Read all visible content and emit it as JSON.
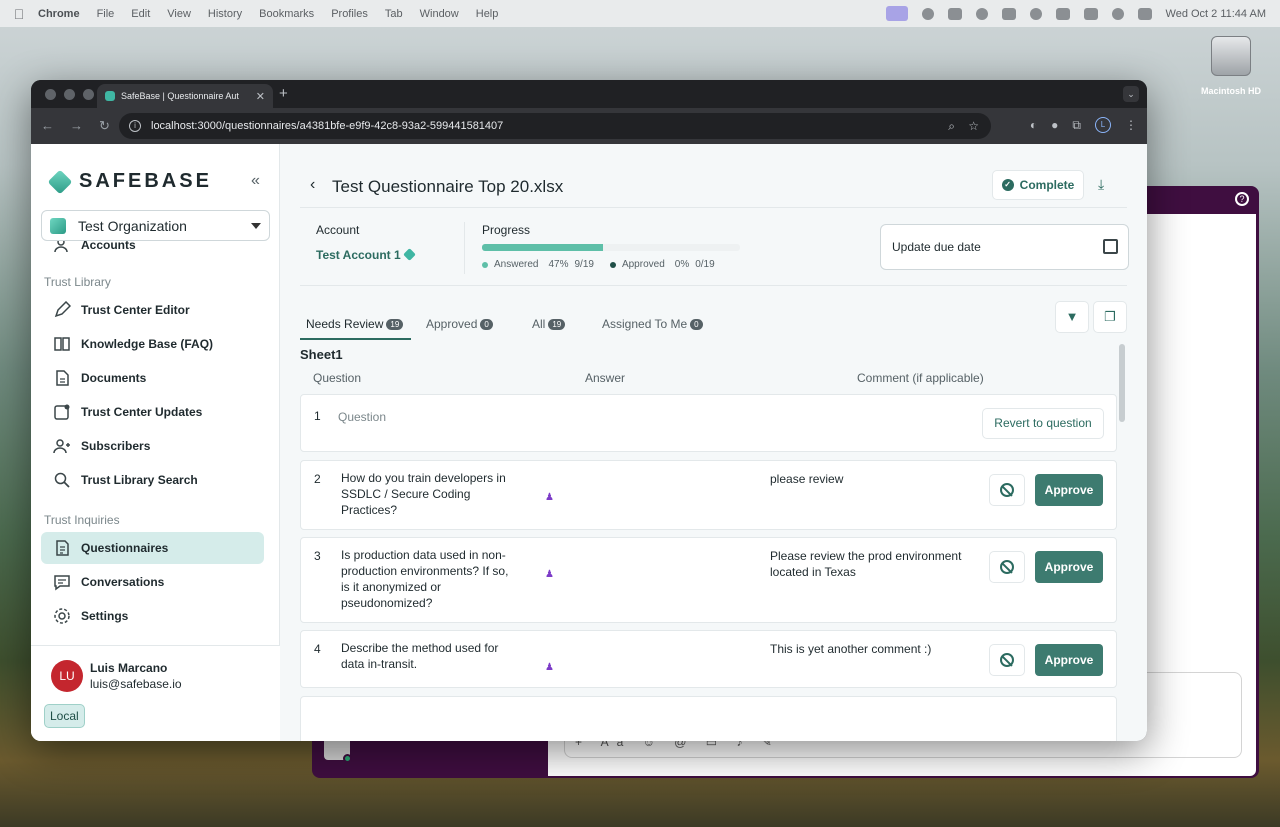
{
  "menubar": {
    "app": "Chrome",
    "items": [
      "File",
      "Edit",
      "View",
      "History",
      "Bookmarks",
      "Profiles",
      "Tab",
      "Window",
      "Help"
    ],
    "clock": "Wed Oct 2  11:44 AM"
  },
  "desktop": {
    "drive_label": "Macintosh HD"
  },
  "browser": {
    "tab_title": "SafeBase | Questionnaire Aut",
    "url": "localhost:3000/questionnaires/a4381bfe-e9f9-42c8-93a2-599441581407",
    "profile_initial": "L"
  },
  "sidebar": {
    "brand": "SAFEBASE",
    "org": "Test Organization",
    "partial_item": "Accounts",
    "section_library": "Trust Library",
    "library_items": [
      "Trust Center Editor",
      "Knowledge Base (FAQ)",
      "Documents",
      "Trust Center Updates",
      "Subscribers",
      "Trust Library Search"
    ],
    "section_inquiries": "Trust Inquiries",
    "inquiry_items": [
      "Questionnaires",
      "Conversations",
      "Settings"
    ],
    "user": {
      "initials": "LU",
      "name": "Luis Marcano",
      "email": "luis@safebase.io"
    },
    "env": "Local"
  },
  "header": {
    "title": "Test Questionnaire Top 20.xlsx",
    "complete_label": "Complete"
  },
  "summary": {
    "account_label": "Account",
    "account_value": "Test Account 1",
    "progress_label": "Progress",
    "progress_fraction": 0.47,
    "answered_label": "Answered",
    "answered_pct": "47%",
    "answered_count": "9/19",
    "approved_label": "Approved",
    "approved_pct": "0%",
    "approved_count": "0/19",
    "due_label": "Update due date"
  },
  "tabs": [
    {
      "label": "Needs Review",
      "count": "19"
    },
    {
      "label": "Approved",
      "count": "0"
    },
    {
      "label": "All",
      "count": "19"
    },
    {
      "label": "Assigned To Me",
      "count": "0"
    }
  ],
  "table": {
    "sheet": "Sheet1",
    "columns": [
      "Question",
      "Answer",
      "Comment (if applicable)"
    ],
    "revert_label": "Revert to question",
    "approve_label": "Approve",
    "rows": [
      {
        "num": "1",
        "question": "Question",
        "comment": ""
      },
      {
        "num": "2",
        "question": "How do you train developers in SSDLC / Secure Coding Practices?",
        "comment": "please review"
      },
      {
        "num": "3",
        "question": "Is production data used in non-production environments? If so, is it anonymized or pseudonomized?",
        "comment": "Please review the prod environment located in Texas"
      },
      {
        "num": "4",
        "question": "Describe the method used for data in-transit.",
        "comment": "This is yet another comment :)"
      }
    ]
  },
  "colors": {
    "accent": "#2c6b60",
    "progress": "#5ebfa8",
    "avatar": "#c4262e"
  }
}
